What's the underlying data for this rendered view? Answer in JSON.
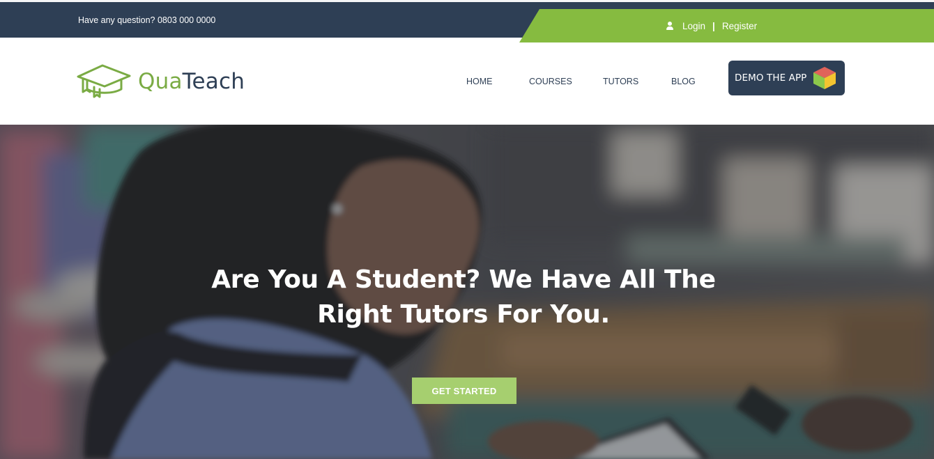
{
  "topbar": {
    "question": "Have any question? 0803 000 0000",
    "login_label": "Login",
    "separator": "|",
    "register_label": "Register"
  },
  "header": {
    "logo": {
      "part1": "Qua",
      "part2": "Teach",
      "icon": "graduation-cap-icon"
    },
    "nav": [
      {
        "label": "HOME"
      },
      {
        "label": "COURSES"
      },
      {
        "label": "TUTORS"
      },
      {
        "label": "BLOG"
      }
    ],
    "demo_button": {
      "label": "DEMO THE APP",
      "icon": "cube-icon"
    }
  },
  "hero": {
    "title_line1": "Are You A Student? We Have All The",
    "title_line2": "Right Tutors For You.",
    "cta_label": "GET STARTED"
  },
  "colors": {
    "navy": "#2e3f55",
    "green": "#86bb40",
    "cta_green": "#a6cf6f",
    "white": "#ffffff"
  }
}
